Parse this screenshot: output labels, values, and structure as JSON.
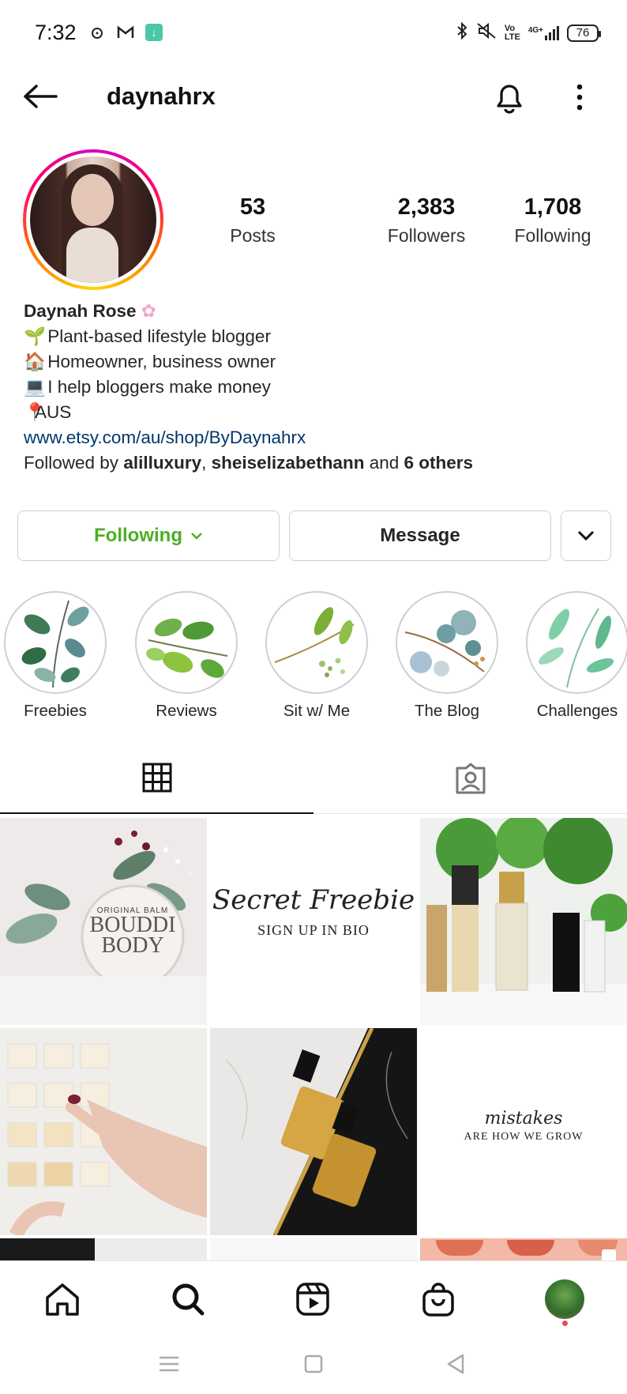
{
  "status_bar": {
    "time": "7:32",
    "battery": "76",
    "network": "4G+"
  },
  "header": {
    "username": "daynahrx"
  },
  "profile": {
    "stats": [
      {
        "value": "53",
        "label": "Posts"
      },
      {
        "value": "2,383",
        "label": "Followers"
      },
      {
        "value": "1,708",
        "label": "Following"
      }
    ],
    "name": "Daynah Rose",
    "bio_lines": [
      "Plant-based lifestyle blogger",
      "Homeowner, business owner",
      "I help bloggers make money",
      "AUS"
    ],
    "link": "www.etsy.com/au/shop/ByDaynahrx",
    "followed_by": {
      "prefix": "Followed by ",
      "user1": "alilluxury",
      "sep": ", ",
      "user2": "sheiselizabethann",
      "and": " and ",
      "others": "6 others"
    }
  },
  "actions": {
    "following_label": "Following",
    "message_label": "Message"
  },
  "highlights": [
    {
      "label": "Freebies"
    },
    {
      "label": "Reviews"
    },
    {
      "label": "Sit w/ Me"
    },
    {
      "label": "The Blog"
    },
    {
      "label": "Challenges"
    }
  ],
  "posts": {
    "balm_label1": "ORIGINAL BALM",
    "balm_label2": "BOUDDI",
    "balm_label3": "BODY",
    "freebie_script": "Secret Freebie",
    "freebie_caps": "SIGN UP IN BIO",
    "mistakes_script": "mistakes",
    "mistakes_caps": "ARE HOW WE GROW"
  },
  "colors": {
    "following_green": "#4caf23",
    "link_blue": "#00376b",
    "notification_dot": "#ed4956"
  }
}
